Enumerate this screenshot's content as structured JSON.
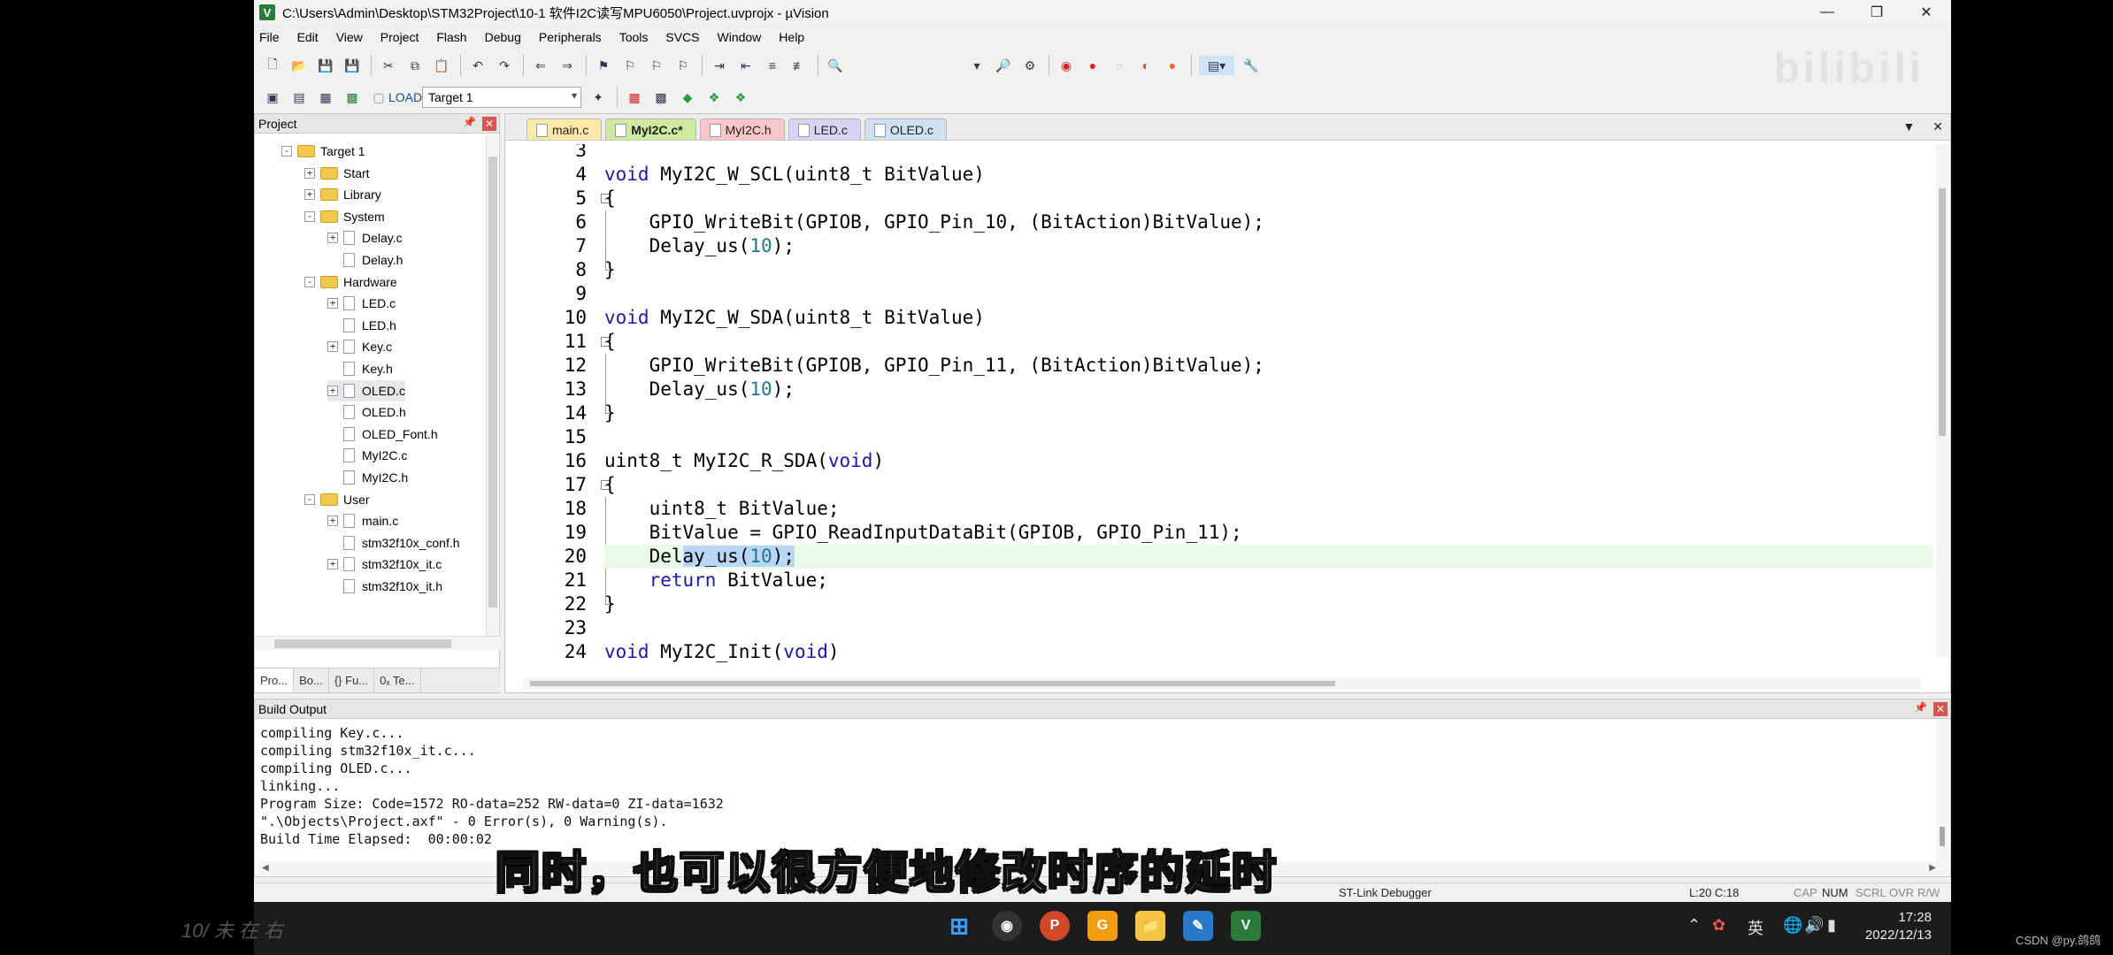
{
  "window": {
    "title": "C:\\Users\\Admin\\Desktop\\STM32Project\\10-1 软件I2C读写MPU6050\\Project.uvprojx - µVision",
    "app_icon": "V"
  },
  "menu": [
    "File",
    "Edit",
    "View",
    "Project",
    "Flash",
    "Debug",
    "Peripherals",
    "Tools",
    "SVCS",
    "Window",
    "Help"
  ],
  "toolbar": {
    "target": "Target 1"
  },
  "project_panel": {
    "title": "Project",
    "tree": [
      {
        "label": "Target 1",
        "type": "target",
        "indent": 0,
        "exp": "-"
      },
      {
        "label": "Start",
        "type": "folder",
        "indent": 1,
        "exp": "+"
      },
      {
        "label": "Library",
        "type": "folder",
        "indent": 1,
        "exp": "+"
      },
      {
        "label": "System",
        "type": "folder",
        "indent": 1,
        "exp": "-"
      },
      {
        "label": "Delay.c",
        "type": "file",
        "indent": 2,
        "exp": "+"
      },
      {
        "label": "Delay.h",
        "type": "file",
        "indent": 2,
        "exp": ""
      },
      {
        "label": "Hardware",
        "type": "folder",
        "indent": 1,
        "exp": "-"
      },
      {
        "label": "LED.c",
        "type": "file",
        "indent": 2,
        "exp": "+"
      },
      {
        "label": "LED.h",
        "type": "file",
        "indent": 2,
        "exp": ""
      },
      {
        "label": "Key.c",
        "type": "file",
        "indent": 2,
        "exp": "+"
      },
      {
        "label": "Key.h",
        "type": "file",
        "indent": 2,
        "exp": ""
      },
      {
        "label": "OLED.c",
        "type": "file",
        "indent": 2,
        "exp": "+",
        "selected": true
      },
      {
        "label": "OLED.h",
        "type": "file",
        "indent": 2,
        "exp": ""
      },
      {
        "label": "OLED_Font.h",
        "type": "file",
        "indent": 2,
        "exp": ""
      },
      {
        "label": "MyI2C.c",
        "type": "file",
        "indent": 2,
        "exp": ""
      },
      {
        "label": "MyI2C.h",
        "type": "file",
        "indent": 2,
        "exp": ""
      },
      {
        "label": "User",
        "type": "folder",
        "indent": 1,
        "exp": "-"
      },
      {
        "label": "main.c",
        "type": "file",
        "indent": 2,
        "exp": "+"
      },
      {
        "label": "stm32f10x_conf.h",
        "type": "file",
        "indent": 2,
        "exp": ""
      },
      {
        "label": "stm32f10x_it.c",
        "type": "file",
        "indent": 2,
        "exp": "+"
      },
      {
        "label": "stm32f10x_it.h",
        "type": "file",
        "indent": 2,
        "exp": ""
      }
    ],
    "bottom_tabs": [
      "Pro...",
      "Bo...",
      "{} Fu...",
      "0ₓ Te..."
    ]
  },
  "editor": {
    "tabs": [
      {
        "label": "main.c",
        "cls": "t-main"
      },
      {
        "label": "MyI2C.c*",
        "cls": "t-myc"
      },
      {
        "label": "MyI2C.h",
        "cls": "t-myh"
      },
      {
        "label": "LED.c",
        "cls": "t-led"
      },
      {
        "label": "OLED.c",
        "cls": "t-oled"
      }
    ],
    "lines": [
      {
        "n": "3",
        "fold": "",
        "html": ""
      },
      {
        "n": "4",
        "fold": "",
        "html": "<span class=\"kw\">void</span> MyI2C_W_SCL(uint8_t BitValue)"
      },
      {
        "n": "5",
        "fold": "box",
        "html": "{"
      },
      {
        "n": "6",
        "fold": "vl",
        "html": "    GPIO_WriteBit(GPIOB, GPIO_Pin_10, (BitAction)BitValue);"
      },
      {
        "n": "7",
        "fold": "vl",
        "html": "    Delay_us(<span class=\"num\">10</span>);"
      },
      {
        "n": "8",
        "fold": "end",
        "html": "}"
      },
      {
        "n": "9",
        "fold": "",
        "html": ""
      },
      {
        "n": "10",
        "fold": "",
        "html": "<span class=\"kw\">void</span> MyI2C_W_SDA(uint8_t BitValue)"
      },
      {
        "n": "11",
        "fold": "box",
        "html": "{"
      },
      {
        "n": "12",
        "fold": "vl",
        "html": "    GPIO_WriteBit(GPIOB, GPIO_Pin_11, (BitAction)BitValue);"
      },
      {
        "n": "13",
        "fold": "vl",
        "html": "    Delay_us(<span class=\"num\">10</span>);"
      },
      {
        "n": "14",
        "fold": "end",
        "html": "}"
      },
      {
        "n": "15",
        "fold": "",
        "html": ""
      },
      {
        "n": "16",
        "fold": "",
        "html": "uint8_t MyI2C_R_SDA(<span class=\"kw\">void</span>)"
      },
      {
        "n": "17",
        "fold": "box",
        "html": "{"
      },
      {
        "n": "18",
        "fold": "vl",
        "html": "    uint8_t BitValue;"
      },
      {
        "n": "19",
        "fold": "vl",
        "html": "    BitValue = GPIO_ReadInputDataBit(GPIOB, GPIO_Pin_11);"
      },
      {
        "n": "20",
        "fold": "vl",
        "html": "    Del<span class=\"selx\">ay_us(<span class=\"num\">10</span>);</span>",
        "current": true
      },
      {
        "n": "21",
        "fold": "vl",
        "html": "    <span class=\"kw\">return</span> BitValue;"
      },
      {
        "n": "22",
        "fold": "end",
        "html": "}"
      },
      {
        "n": "23",
        "fold": "",
        "html": ""
      },
      {
        "n": "24",
        "fold": "",
        "html": "<span class=\"kw\">void</span> MyI2C_Init(<span class=\"kw\">void</span>)"
      }
    ]
  },
  "build_output": {
    "title": "Build Output",
    "lines": [
      "compiling Key.c...",
      "compiling stm32f10x_it.c...",
      "compiling OLED.c...",
      "linking...",
      "Program Size: Code=1572 RO-data=252 RW-data=0 ZI-data=1632",
      "\".\\Objects\\Project.axf\" - 0 Error(s), 0 Warning(s).",
      "Build Time Elapsed:  00:00:02"
    ]
  },
  "status": {
    "debugger": "ST-Link Debugger",
    "position": "L:20 C:18",
    "cap": "CAP",
    "num": "NUM",
    "scrl": "SCRL",
    "ovr": "OVR",
    "rw": "R/W"
  },
  "subtitle": "同时，也可以很方便地修改时序的延时",
  "taskbar": {
    "tray_lang": "英",
    "time": "17:28",
    "date": "2022/12/13"
  },
  "watermark_left": "10/ 未 在 右",
  "watermark_right": "CSDN @py.鸽鸽",
  "colors": {
    "current_line": "#e8fbe8",
    "selection": "#b8d6f5",
    "keyword": "#1a1aa6",
    "number": "#1c7a8c"
  }
}
